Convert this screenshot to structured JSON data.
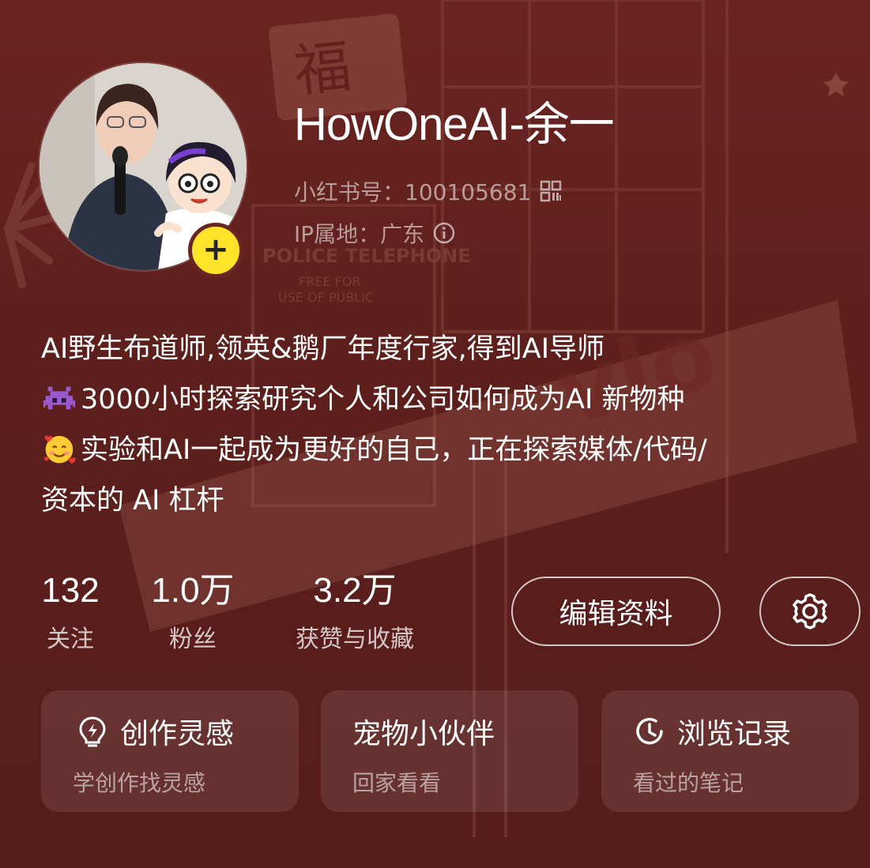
{
  "profile": {
    "nickname": "HowOneAI-余一",
    "red_id": "小红书号：100105681",
    "ip_location": "IP属地：广东",
    "avatar_add_symbol": "+"
  },
  "bio": {
    "line1": "AI野生布道师,领英&鹅厂年度行家,得到AI导师",
    "line2_emoji": "alien-monster-emoji",
    "line2": "3000小时探索研究个人和公司如何成为AI 新物种",
    "line3_emoji": "smiling-face-with-hearts-emoji",
    "line3": "实验和AI一起成为更好的自己，正在探索媒体/代码/",
    "line4": "资本的 AI 杠杆"
  },
  "stats": [
    {
      "value": "132",
      "label": "关注"
    },
    {
      "value": "1.0万",
      "label": "粉丝"
    },
    {
      "value": "3.2万",
      "label": "获赞与收藏"
    }
  ],
  "actions": {
    "edit_label": "编辑资料",
    "settings_icon": "gear-icon"
  },
  "cards": [
    {
      "icon": "lightbulb-icon",
      "title": "创作灵感",
      "subtitle": "学创作找灵感"
    },
    {
      "icon": "",
      "title": "宠物小伙伴",
      "subtitle": "回家看看"
    },
    {
      "icon": "clock-icon",
      "title": "浏览记录",
      "subtitle": "看过的笔记"
    }
  ],
  "colors": {
    "background": "#5d1f1c",
    "badge": "#ffe42a",
    "text": "#ffffff"
  }
}
